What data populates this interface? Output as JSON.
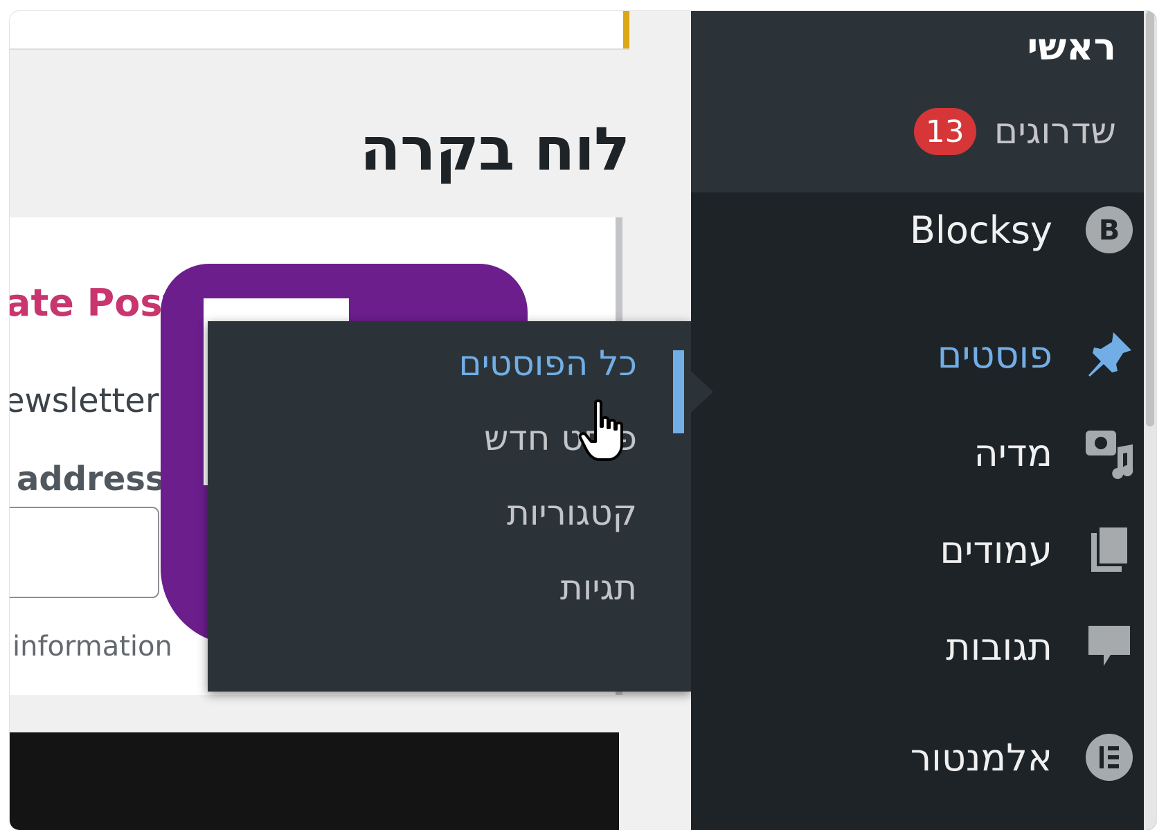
{
  "page": {
    "title": "לוח בקרה"
  },
  "widget": {
    "title_fragment": "ate Post",
    "text_fragment": "ewsletter",
    "label_fragment": "address",
    "note_fragment": "information"
  },
  "sidebar": {
    "home": "ראשי",
    "updates": {
      "label": "שדרוגים",
      "count": "13"
    },
    "items": [
      {
        "label": "Blocksy",
        "icon": "blocksy-icon"
      },
      {
        "label": "פוסטים",
        "icon": "pin-icon",
        "active": true
      },
      {
        "label": "מדיה",
        "icon": "media-icon"
      },
      {
        "label": "עמודים",
        "icon": "pages-icon"
      },
      {
        "label": "תגובות",
        "icon": "comments-icon"
      },
      {
        "label": "אלמנטור",
        "icon": "elementor-icon"
      }
    ]
  },
  "submenu": {
    "items": [
      {
        "label": "כל הפוסטים",
        "current": true
      },
      {
        "label": "פוסט חדש"
      },
      {
        "label": "קטגוריות"
      },
      {
        "label": "תגיות"
      }
    ]
  },
  "colors": {
    "sidebar_bg": "#1d2327",
    "sidebar_top_bg": "#2c3338",
    "active": "#72aee6",
    "badge": "#d63638",
    "accent_topbar": "#dba617",
    "logo_purple": "#6b1e8c",
    "widget_title": "#c9356e"
  }
}
